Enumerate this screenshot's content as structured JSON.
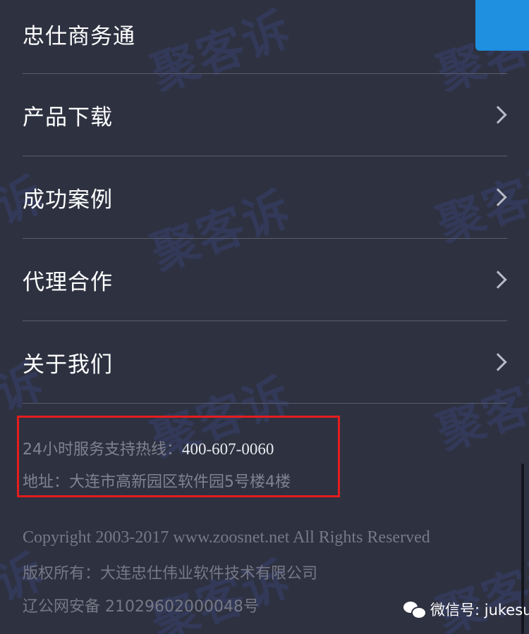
{
  "menu": {
    "items": [
      {
        "label": "忠仕商务通",
        "has_arrow": false
      },
      {
        "label": "产品下载",
        "has_arrow": true
      },
      {
        "label": "成功案例",
        "has_arrow": true
      },
      {
        "label": "代理合作",
        "has_arrow": true
      },
      {
        "label": "关于我们",
        "has_arrow": true
      }
    ]
  },
  "contact": {
    "hotline_label": "24小时服务支持热线：",
    "hotline_number": "400-607-0060",
    "address": "地址：大连市高新园区软件园5号楼4楼"
  },
  "footer": {
    "copyright": "Copyright 2003-2017 www.zoosnet.net All Rights Reserved",
    "owner": "版权所有：大连忠仕伟业软件技术有限公司",
    "icp": "辽公网安备 21029602000048号"
  },
  "watermark": {
    "text": "聚客诉"
  },
  "wechat_badge": {
    "text": "微信号: jukesu",
    "icon": "wechat-icon"
  },
  "colors": {
    "background": "#2e3140",
    "accent_blue": "#1f8fe0",
    "highlight_border": "#e51d1d",
    "divider": "#5a5d6a"
  }
}
